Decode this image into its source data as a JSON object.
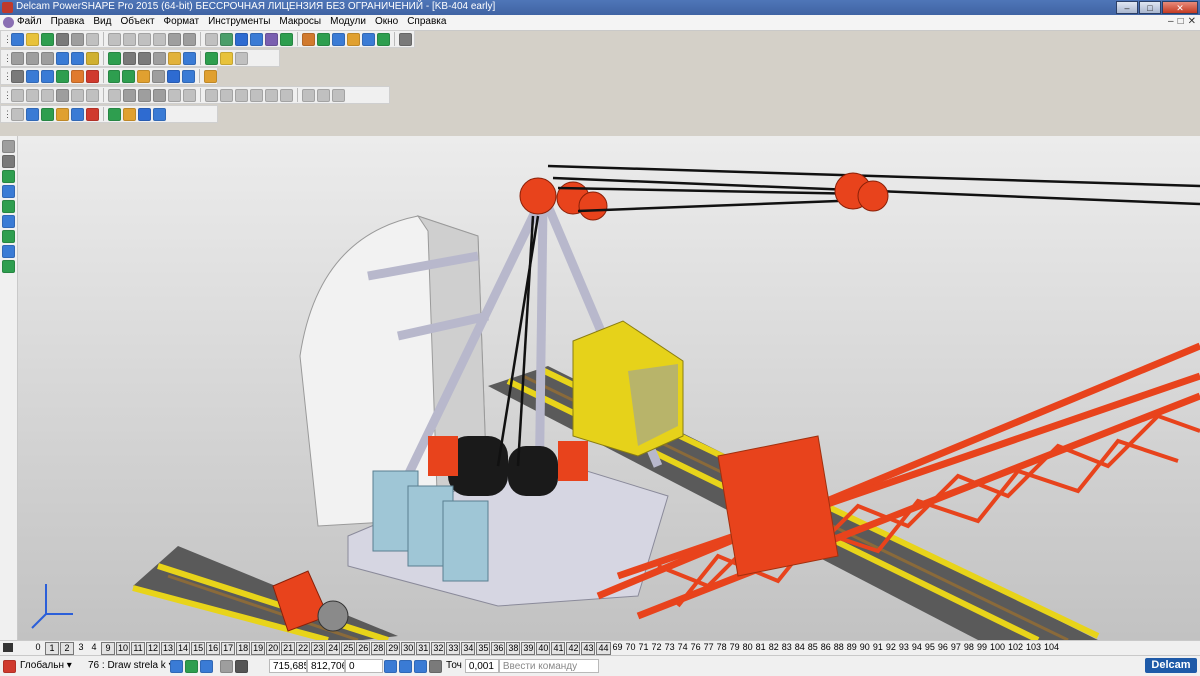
{
  "window": {
    "title": "Delcam PowerSHAPE Pro 2015 (64-bit) БЕССРОЧНАЯ ЛИЦЕНЗИЯ БЕЗ ОГРАНИЧЕНИЙ - [KB-404 early]",
    "minimize": "–",
    "maximize": "□",
    "close": "✕"
  },
  "menu": {
    "items": [
      "Файл",
      "Правка",
      "Вид",
      "Объект",
      "Формат",
      "Инструменты",
      "Макросы",
      "Модули",
      "Окно",
      "Справка"
    ],
    "mdi": [
      "–",
      "□",
      "✕"
    ]
  },
  "toolbars": {
    "row1_icon_colors": [
      "#3a7bd5",
      "#e8c23a",
      "#2e9e4f",
      "#7a7a7a",
      "#9e9e9e",
      "#c0c0c0",
      "#c0c0c0",
      "#c0c0c0",
      "#c0c0c0",
      "#c0c0c0",
      "#9e9e9e",
      "#9e9e9e",
      "#c0c0c0",
      "#4a9e6a",
      "#2e6bd1",
      "#3a7bd5",
      "#7a5fb0",
      "#2e9e4f",
      "#d17a2e",
      "#2e9e4f",
      "#3a7bd5",
      "#e0a030",
      "#3a7bd5",
      "#2e9e4f",
      "#7a7a7a"
    ],
    "row2_icon_colors": [
      "#9e9e9e",
      "#9e9e9e",
      "#9e9e9e",
      "#3a7bd5",
      "#3a7bd5",
      "#d0b030",
      "#2e9e4f",
      "#7a7a7a",
      "#7a7a7a",
      "#9e9e9e",
      "#e2b23a",
      "#3a7bd5",
      "#2e9e4f",
      "#e8c23a",
      "#c0c0c0"
    ],
    "row3_icon_colors": [
      "#7a7a7a",
      "#3a7bd5",
      "#3a7bd5",
      "#2e9e4f",
      "#e07a2e",
      "#d03a2e",
      "#2e9e4f",
      "#2e9e4f",
      "#e0a030",
      "#9e9e9e",
      "#2e6bd1",
      "#3a7bd5",
      "#e0a030"
    ],
    "row4_icon_colors": [
      "#c0c0c0",
      "#c0c0c0",
      "#c0c0c0",
      "#9e9e9e",
      "#c0c0c0",
      "#c0c0c0",
      "#c0c0c0",
      "#9e9e9e",
      "#9e9e9e",
      "#9e9e9e",
      "#c0c0c0",
      "#c0c0c0",
      "#c0c0c0",
      "#c0c0c0",
      "#c0c0c0",
      "#c0c0c0",
      "#c0c0c0",
      "#c0c0c0",
      "#c0c0c0",
      "#c0c0c0",
      "#c0c0c0"
    ],
    "row5_icon_colors": [
      "#c0c0c0",
      "#3a7bd5",
      "#2e9e4f",
      "#e0a030",
      "#3a7bd5",
      "#d03a2e",
      "#2e9e4f",
      "#e0a030",
      "#2e6bd1",
      "#3a7bd5"
    ],
    "left_icon_colors": [
      "#9e9e9e",
      "#7a7a7a",
      "#2e9e4f",
      "#3a7bd5",
      "#2e9e4f",
      "#3a7bd5",
      "#2e9e4f",
      "#3a7bd5",
      "#2e9e4f"
    ]
  },
  "levels": {
    "items": [
      {
        "label": "0",
        "boxed": false
      },
      {
        "label": "1",
        "boxed": true
      },
      {
        "label": "2",
        "boxed": true
      },
      {
        "label": "3",
        "boxed": false
      },
      {
        "label": "4",
        "boxed": false
      },
      {
        "label": "9",
        "boxed": true
      },
      {
        "label": "10",
        "boxed": true
      },
      {
        "label": "11",
        "boxed": true
      },
      {
        "label": "12",
        "boxed": true
      },
      {
        "label": "13",
        "boxed": true
      },
      {
        "label": "14",
        "boxed": true
      },
      {
        "label": "15",
        "boxed": true
      },
      {
        "label": "16",
        "boxed": true
      },
      {
        "label": "17",
        "boxed": true
      },
      {
        "label": "18",
        "boxed": true
      },
      {
        "label": "19",
        "boxed": true
      },
      {
        "label": "20",
        "boxed": true
      },
      {
        "label": "21",
        "boxed": true
      },
      {
        "label": "22",
        "boxed": true
      },
      {
        "label": "23",
        "boxed": true
      },
      {
        "label": "24",
        "boxed": true
      },
      {
        "label": "25",
        "boxed": true
      },
      {
        "label": "26",
        "boxed": true
      },
      {
        "label": "28",
        "boxed": true
      },
      {
        "label": "29",
        "boxed": true
      },
      {
        "label": "30",
        "boxed": true
      },
      {
        "label": "31",
        "boxed": true
      },
      {
        "label": "32",
        "boxed": true
      },
      {
        "label": "33",
        "boxed": true
      },
      {
        "label": "34",
        "boxed": true
      },
      {
        "label": "35",
        "boxed": true
      },
      {
        "label": "36",
        "boxed": true
      },
      {
        "label": "38",
        "boxed": true
      },
      {
        "label": "39",
        "boxed": true
      },
      {
        "label": "40",
        "boxed": true
      },
      {
        "label": "41",
        "boxed": true
      },
      {
        "label": "42",
        "boxed": true
      },
      {
        "label": "43",
        "boxed": true
      },
      {
        "label": "44",
        "boxed": true
      },
      {
        "label": "69",
        "boxed": false
      },
      {
        "label": "70",
        "boxed": false
      },
      {
        "label": "71",
        "boxed": false
      },
      {
        "label": "72",
        "boxed": false
      },
      {
        "label": "73",
        "boxed": false
      },
      {
        "label": "74",
        "boxed": false
      },
      {
        "label": "76",
        "boxed": false
      },
      {
        "label": "77",
        "boxed": false
      },
      {
        "label": "78",
        "boxed": false
      },
      {
        "label": "79",
        "boxed": false
      },
      {
        "label": "80",
        "boxed": false
      },
      {
        "label": "81",
        "boxed": false
      },
      {
        "label": "82",
        "boxed": false
      },
      {
        "label": "83",
        "boxed": false
      },
      {
        "label": "84",
        "boxed": false
      },
      {
        "label": "85",
        "boxed": false
      },
      {
        "label": "86",
        "boxed": false
      },
      {
        "label": "88",
        "boxed": false
      },
      {
        "label": "89",
        "boxed": false
      },
      {
        "label": "90",
        "boxed": false
      },
      {
        "label": "91",
        "boxed": false
      },
      {
        "label": "92",
        "boxed": false
      },
      {
        "label": "93",
        "boxed": false
      },
      {
        "label": "94",
        "boxed": false
      },
      {
        "label": "95",
        "boxed": false
      },
      {
        "label": "96",
        "boxed": false
      },
      {
        "label": "97",
        "boxed": false
      },
      {
        "label": "98",
        "boxed": false
      },
      {
        "label": "99",
        "boxed": false
      },
      {
        "label": "100",
        "boxed": false
      },
      {
        "label": "102",
        "boxed": false
      },
      {
        "label": "103",
        "boxed": false
      },
      {
        "label": "104",
        "boxed": false
      }
    ]
  },
  "status": {
    "workplane": "Глобальн ▾",
    "level": "76 : Draw strela k ▾",
    "coord_x": "715,685",
    "coord_y": "812,706",
    "coord_z": "0",
    "tol_label": "Точ",
    "tol_value": "0,001",
    "command_placeholder": "Ввести команду",
    "logo": "Delcam"
  },
  "colors": {
    "boom_red": "#e8431c",
    "counterweight": "#f2f2f2",
    "cab_yellow": "#e6d21a",
    "frame_gray": "#c9c9d8",
    "rail_yellow": "#e8d41a"
  }
}
